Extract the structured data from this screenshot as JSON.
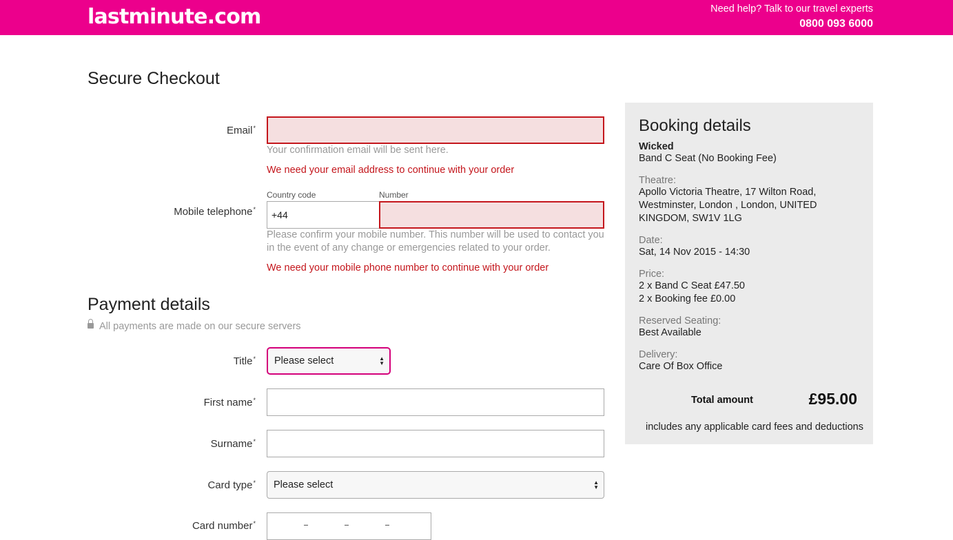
{
  "header": {
    "logo": "lastminute.com",
    "help_text": "Need help? Talk to our travel experts",
    "phone": "0800 093 6000",
    "brand_color": "#ec008c"
  },
  "page_title": "Secure Checkout",
  "contact": {
    "email_label": "Email",
    "email_value": "",
    "email_hint": "Your confirmation email will be sent here.",
    "email_error": "We need your email address to continue with your order",
    "mobile_label": "Mobile telephone",
    "country_code_label": "Country code",
    "country_code_value": "+44",
    "number_label": "Number",
    "number_value": "",
    "mobile_hint": "Please confirm your mobile number. This number will be used to contact you in the event of any change or emergencies related to your order.",
    "mobile_error": "We need your mobile phone number to continue with your order"
  },
  "payment": {
    "title": "Payment details",
    "secure_note": "All payments are made on our secure servers",
    "title_label": "Title",
    "title_value": "Please select",
    "first_name_label": "First name",
    "first_name_value": "",
    "surname_label": "Surname",
    "surname_value": "",
    "card_type_label": "Card type",
    "card_type_value": "Please select",
    "card_number_label": "Card number"
  },
  "booking": {
    "title": "Booking details",
    "show_name": "Wicked",
    "seat_type": "Band C Seat (No Booking Fee)",
    "theatre_label": "Theatre:",
    "theatre_value": "Apollo Victoria Theatre, 17 Wilton Road, Westminster, London , London, UNITED KINGDOM, SW1V 1LG",
    "date_label": "Date:",
    "date_value": "Sat, 14 Nov 2015 - 14:30",
    "price_label": "Price:",
    "price_line1": "2 x Band C Seat £47.50",
    "price_line2": "2 x Booking fee £0.00",
    "seating_label": "Reserved Seating:",
    "seating_value": "Best Available",
    "delivery_label": "Delivery:",
    "delivery_value": "Care Of Box Office",
    "total_label": "Total amount",
    "total_value": "£95.00",
    "total_note": "includes any applicable card fees and deductions"
  }
}
